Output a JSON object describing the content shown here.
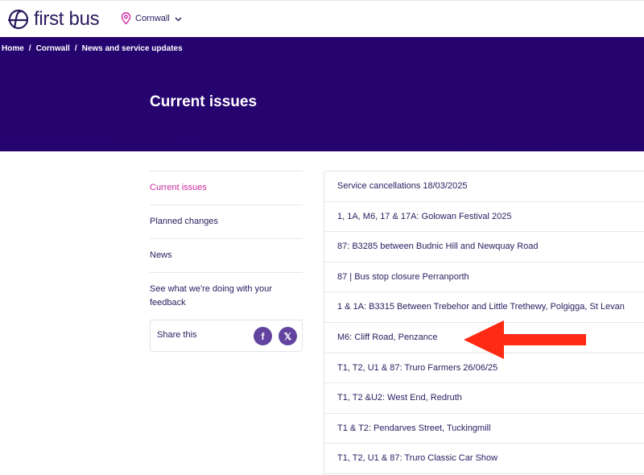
{
  "header": {
    "logo_text": "first bus",
    "region": "Cornwall",
    "colors": {
      "brand": "#2a1a5e",
      "hero": "#250470",
      "active": "#cc2a9c",
      "share_button": "#6244a0",
      "annotation_arrow": "#ff2a14"
    },
    "icons": {
      "logo": "first-bus-logo-mark",
      "region": "map-pin-icon",
      "dropdown": "chevron-down-icon"
    }
  },
  "breadcrumb": [
    "Home",
    "Cornwall",
    "News and service updates"
  ],
  "breadcrumb_separator": "/",
  "hero": {
    "title": "Current issues"
  },
  "sidenav": {
    "items": [
      {
        "label": "Current issues",
        "active": true
      },
      {
        "label": "Planned changes",
        "active": false
      },
      {
        "label": "News",
        "active": false
      },
      {
        "label": "See what we're doing with your feedback",
        "active": false
      }
    ],
    "share_label": "Share this",
    "share_icons": [
      "facebook-icon",
      "x-icon"
    ],
    "share_glyphs": {
      "facebook": "f",
      "x": "𝕏"
    }
  },
  "issues": [
    "Service cancellations 18/03/2025",
    "1, 1A, M6, 17 & 17A: Golowan Festival 2025",
    "87: B3285 between Budnic Hill and Newquay Road",
    "87 | Bus stop closure Perranporth",
    "1 & 1A: B3315 Between Trebehor and Little Trethewy, Polgigga, St Levan",
    "M6: Cliff Road, Penzance",
    "T1, T2, U1 & 87: Truro Farmers 26/06/25",
    "T1, T2 &U2: West End, Redruth",
    "T1 & T2: Pendarves Street, Tuckingmill",
    "T1, T2, U1 & 87: Truro Classic Car Show"
  ],
  "annotation": {
    "icon": "red-arrow-pointer",
    "points_to_item": "M6: Cliff Road, Penzance"
  }
}
